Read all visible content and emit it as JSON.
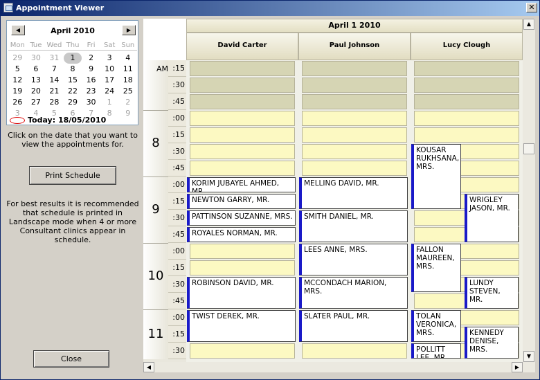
{
  "window": {
    "title": "Appointment Viewer",
    "close_glyph": "✕"
  },
  "calendar": {
    "month_label": "April 2010",
    "prev_glyph": "◀",
    "next_glyph": "▶",
    "weekdays": [
      "Mon",
      "Tue",
      "Wed",
      "Thu",
      "Fri",
      "Sat",
      "Sun"
    ],
    "days": [
      {
        "d": "29",
        "other": true
      },
      {
        "d": "30",
        "other": true
      },
      {
        "d": "31",
        "other": true
      },
      {
        "d": "1",
        "sel": true
      },
      {
        "d": "2"
      },
      {
        "d": "3"
      },
      {
        "d": "4"
      },
      {
        "d": "5"
      },
      {
        "d": "6"
      },
      {
        "d": "7"
      },
      {
        "d": "8"
      },
      {
        "d": "9"
      },
      {
        "d": "10"
      },
      {
        "d": "11"
      },
      {
        "d": "12"
      },
      {
        "d": "13"
      },
      {
        "d": "14"
      },
      {
        "d": "15"
      },
      {
        "d": "16"
      },
      {
        "d": "17"
      },
      {
        "d": "18"
      },
      {
        "d": "19"
      },
      {
        "d": "20"
      },
      {
        "d": "21"
      },
      {
        "d": "22"
      },
      {
        "d": "23"
      },
      {
        "d": "24"
      },
      {
        "d": "25"
      },
      {
        "d": "26"
      },
      {
        "d": "27"
      },
      {
        "d": "28"
      },
      {
        "d": "29"
      },
      {
        "d": "30"
      },
      {
        "d": "1",
        "other": true
      },
      {
        "d": "2",
        "other": true
      },
      {
        "d": "3",
        "other": true
      },
      {
        "d": "4",
        "other": true
      },
      {
        "d": "5",
        "other": true
      },
      {
        "d": "6",
        "other": true
      },
      {
        "d": "7",
        "other": true
      },
      {
        "d": "8",
        "other": true
      },
      {
        "d": "9",
        "other": true
      }
    ],
    "today_label": "Today: 18/05/2010"
  },
  "instructions": "Click on the date that you want to view the appointments for.",
  "print_button": "Print Schedule",
  "landscape_note": "For best results it is recommended that schedule is printed in Landscape mode when 4 or more Consultant clinics appear in schedule.",
  "close_button": "Close",
  "schedule": {
    "date_header": "April 1 2010",
    "consultants": [
      "David Carter",
      "Paul Johnson",
      "Lucy Clough"
    ],
    "hours": [
      {
        "label": "AM",
        "am": true,
        "mins": [
          ":15",
          ":30",
          ":45"
        ]
      },
      {
        "label": "8",
        "mins": [
          ":00",
          ":15",
          ":30",
          ":45"
        ]
      },
      {
        "label": "9",
        "mins": [
          ":00",
          ":15",
          ":30",
          ":45"
        ]
      },
      {
        "label": "10",
        "mins": [
          ":00",
          ":15",
          ":30",
          ":45"
        ]
      },
      {
        "label": "11",
        "mins": [
          ":00",
          ":15",
          ":30"
        ]
      }
    ],
    "appointments": [
      {
        "col": 0,
        "slot": 7,
        "span": 1,
        "name": "KORIM JUBAYEL AHMED, MR."
      },
      {
        "col": 0,
        "slot": 8,
        "span": 1,
        "name": "NEWTON GARRY, MR."
      },
      {
        "col": 0,
        "slot": 9,
        "span": 1,
        "name": "PATTINSON SUZANNE, MRS."
      },
      {
        "col": 0,
        "slot": 10,
        "span": 1,
        "name": "ROYALES NORMAN, MR."
      },
      {
        "col": 0,
        "slot": 13,
        "span": 2,
        "name": "ROBINSON DAVID, MR."
      },
      {
        "col": 0,
        "slot": 15,
        "span": 2,
        "name": "TWIST DEREK, MR."
      },
      {
        "col": 1,
        "slot": 7,
        "span": 2,
        "name": "MELLING DAVID, MR."
      },
      {
        "col": 1,
        "slot": 9,
        "span": 2,
        "name": "SMITH DANIEL, MR."
      },
      {
        "col": 1,
        "slot": 11,
        "span": 2,
        "name": "LEES ANNE, MRS."
      },
      {
        "col": 1,
        "slot": 13,
        "span": 2,
        "name": "MCCONDACH MARION, MRS."
      },
      {
        "col": 1,
        "slot": 15,
        "span": 2,
        "name": "SLATER PAUL, MR."
      },
      {
        "col": 2,
        "slot": 5,
        "span": 4,
        "name": "KOUSAR RUKHSANA, MRS.",
        "half": "left"
      },
      {
        "col": 2,
        "slot": 8,
        "span": 3,
        "name": "WRIGLEY JASON, MR.",
        "half": "right"
      },
      {
        "col": 2,
        "slot": 11,
        "span": 3,
        "name": "FALLON MAUREEN, MRS.",
        "half": "left"
      },
      {
        "col": 2,
        "slot": 13,
        "span": 2,
        "name": "LUNDY STEVEN, MR.",
        "half": "right"
      },
      {
        "col": 2,
        "slot": 15,
        "span": 2,
        "name": "TOLAN VERONICA, MRS.",
        "half": "left"
      },
      {
        "col": 2,
        "slot": 16,
        "span": 2,
        "name": "KENNEDY DENISE, MRS.",
        "half": "right"
      },
      {
        "col": 2,
        "slot": 17,
        "span": 1,
        "name": "POLLITT LEE, MR.",
        "half": "left"
      }
    ]
  },
  "scroll": {
    "up": "▲",
    "down": "▼",
    "left": "◀",
    "right": "▶"
  }
}
